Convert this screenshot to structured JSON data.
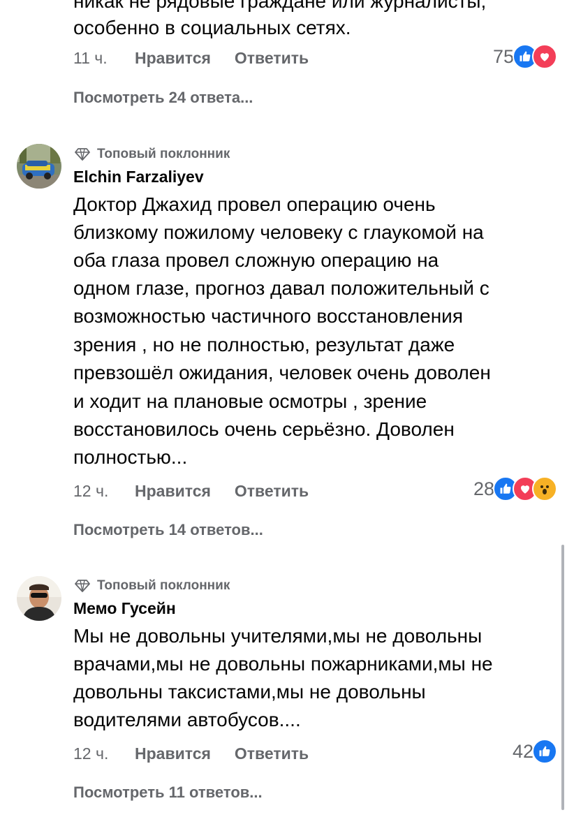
{
  "comments": [
    {
      "text_lines": [
        "никак не рядовые граждане или журналисты,",
        "особенно в социальных сетях."
      ],
      "time": "11 ч.",
      "like_label": "Нравится",
      "reply_label": "Ответить",
      "reaction_count": "75",
      "reactions": [
        "like-icon",
        "love-icon"
      ],
      "view_replies": "Посмотреть 24 ответа..."
    },
    {
      "badge": "Топовый поклонник",
      "author": "Elchin Farzaliyev",
      "text_lines": [
        "Доктор Джахид провел операцию очень",
        "близкому пожилому человеку с глаукомой на",
        "оба глаза провел сложную операцию на",
        "одном глазе, прогноз давал положительный с",
        "возможностью частичного восстановления",
        "зрения , но не полностью,  результат даже",
        "превзошёл ожидания,  человек очень доволен",
        "и ходит на плановые осмотры , зрение",
        "восстановилось очень серьёзно.  Доволен",
        "полностью..."
      ],
      "time": "12 ч.",
      "like_label": "Нравится",
      "reply_label": "Ответить",
      "reaction_count": "28",
      "reactions": [
        "like-icon",
        "love-icon",
        "wow-icon"
      ],
      "view_replies": "Посмотреть 14 ответов..."
    },
    {
      "badge": "Топовый поклонник",
      "author": "Мемо Гусейн",
      "text_lines": [
        "Мы не довольны учителями,мы не довольны",
        "врачами,мы не довольны пожарниками,мы не",
        "довольны таксистами,мы не  довольны",
        "водителями  автобусов...."
      ],
      "time": "12 ч.",
      "like_label": "Нравится",
      "reply_label": "Ответить",
      "reaction_count": "42",
      "reactions": [
        "like-icon"
      ],
      "view_replies": "Посмотреть 11 ответов..."
    }
  ],
  "colors": {
    "text": "#050505",
    "secondary": "#65676b",
    "like": "#1877f2",
    "love": "#f33e58",
    "wow": "#f7b125"
  }
}
